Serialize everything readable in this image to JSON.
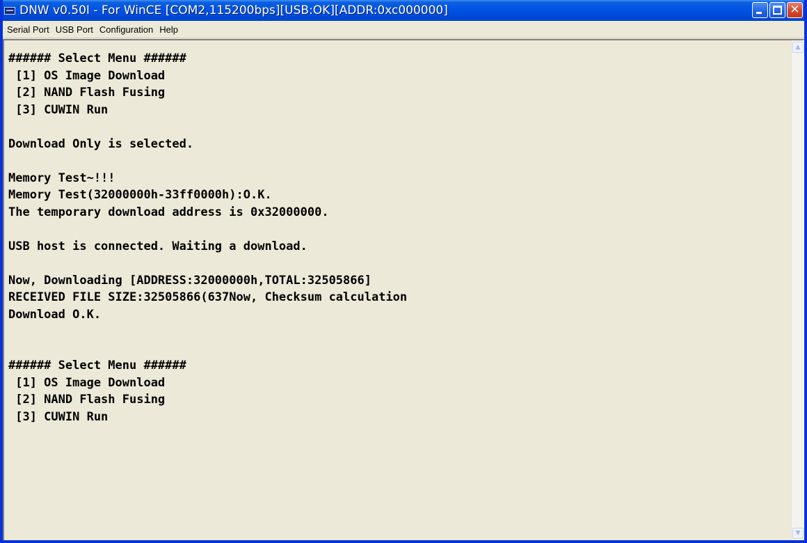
{
  "window": {
    "title": "DNW v0.50I - For WinCE   [COM2,115200bps][USB:OK][ADDR:0xc000000]",
    "app_icon": "dnw-app-icon"
  },
  "caption_buttons": {
    "minimize_icon": "minimize-icon",
    "maximize_icon": "maximize-icon",
    "close_icon": "close-icon",
    "close_glyph": "✕"
  },
  "menu": {
    "items": [
      {
        "label": "Serial Port"
      },
      {
        "label": "USB Port"
      },
      {
        "label": "Configuration"
      },
      {
        "label": "Help"
      }
    ]
  },
  "terminal": {
    "lines": [
      "###### Select Menu ######",
      " [1] OS Image Download",
      " [2] NAND Flash Fusing",
      " [3] CUWIN Run",
      "",
      "Download Only is selected.",
      "",
      "Memory Test~!!!",
      "Memory Test(32000000h-33ff0000h):O.K.",
      "The temporary download address is 0x32000000.",
      "",
      "USB host is connected. Waiting a download.",
      "",
      "Now, Downloading [ADDRESS:32000000h,TOTAL:32505866]",
      "RECEIVED FILE SIZE:32505866(637Now, Checksum calculation",
      "Download O.K.",
      "",
      "",
      "###### Select Menu ######",
      " [1] OS Image Download",
      " [2] NAND Flash Fusing",
      " [3] CUWIN Run"
    ]
  },
  "scrollbar": {
    "up_icon": "scroll-up-arrow-icon",
    "down_icon": "scroll-down-arrow-icon",
    "up_glyph": "▲",
    "down_glyph": "▼"
  }
}
